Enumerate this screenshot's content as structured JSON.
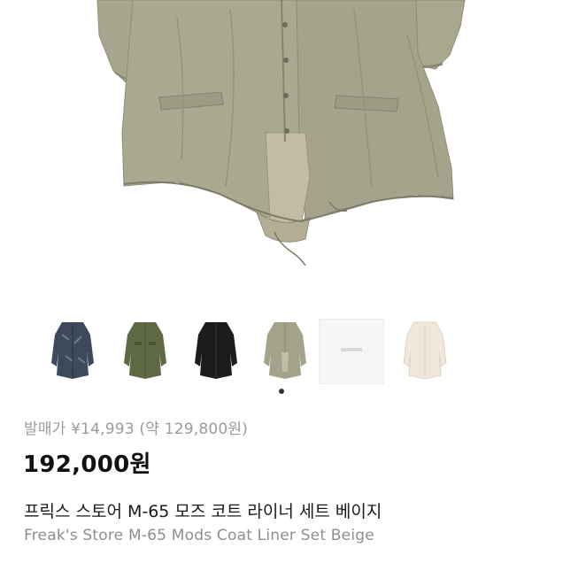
{
  "product": {
    "original_price_label": "발매가 ¥14,993 (약 129,800원)",
    "price": "192,000원",
    "title_ko": "프릭스 스토어 M-65 모즈 코트 라이너 세트 베이지",
    "title_en": "Freak's Store M-65 Mods Coat Liner Set Beige"
  },
  "gallery": {
    "thumbnails": [
      {
        "icon": "navy-camo-coat-thumbnail",
        "color": "#3e4a5c"
      },
      {
        "icon": "olive-coat-thumbnail",
        "color": "#5f6a45"
      },
      {
        "icon": "black-coat-thumbnail",
        "color": "#1c1c1c"
      },
      {
        "icon": "beige-coat-thumbnail",
        "color": "#a5a28c"
      },
      {
        "icon": "packaging-card-thumbnail",
        "color": "#f6f6f6"
      },
      {
        "icon": "ivory-coat-thumbnail",
        "color": "#efe9dc"
      }
    ],
    "active_index": 3
  },
  "colors": {
    "coat_beige": "#a7a48d",
    "coat_shadow": "#8c8a73",
    "price_text": "#111111",
    "muted_text": "#9b9b9b"
  }
}
